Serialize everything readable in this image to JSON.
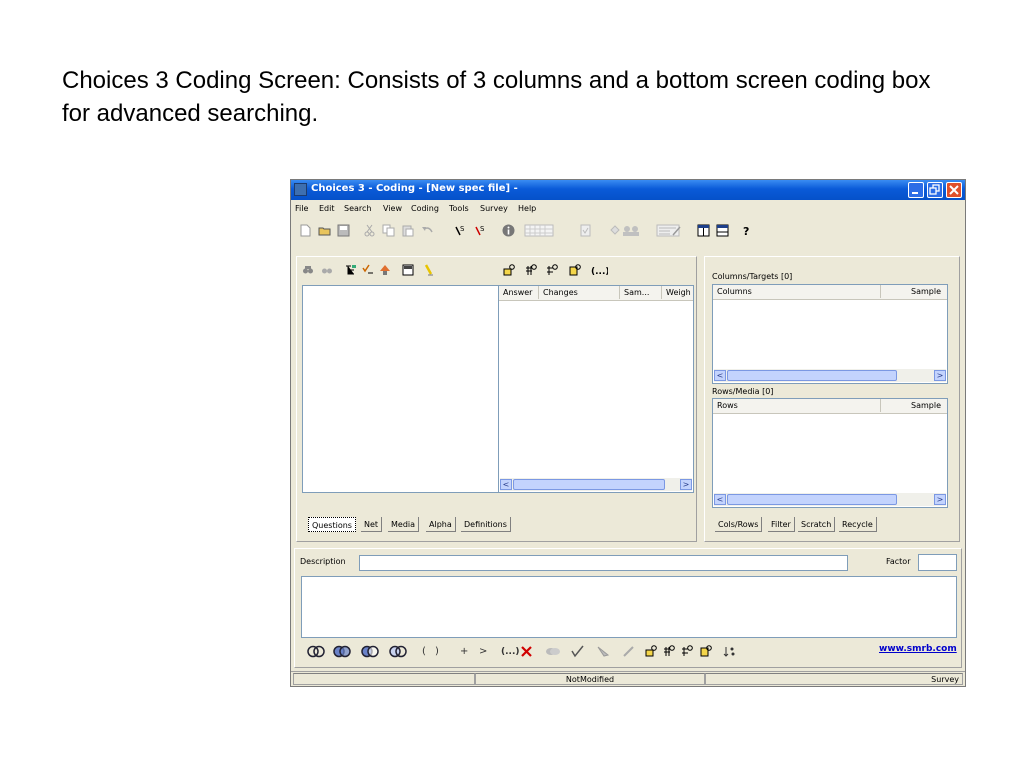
{
  "caption": "Choices 3 Coding Screen:  Consists of 3 columns and a bottom screen coding box for advanced searching.",
  "window": {
    "title": "Choices 3 - Coding - [New spec file] -"
  },
  "menu": [
    "File",
    "Edit",
    "Search",
    "View",
    "Coding",
    "Tools",
    "Survey",
    "Help"
  ],
  "middle_panel": {
    "columns": [
      "Answer",
      "Changes",
      "Sam...",
      "Weigh"
    ]
  },
  "left_tabs": [
    "Questions",
    "Net",
    "Media",
    "Alpha",
    "Definitions"
  ],
  "right_panel": {
    "columns_group_label": "Columns/Targets [0]",
    "columns_table_headers": [
      "Columns",
      "Sample"
    ],
    "rows_group_label": "Rows/Media [0]",
    "rows_table_headers": [
      "Rows",
      "Sample"
    ]
  },
  "right_tabs": [
    "Cols/Rows",
    "Filter",
    "Scratch",
    "Recycle"
  ],
  "coding_box": {
    "description_label": "Description",
    "factor_label": "Factor",
    "website_link": "www.smrb.com"
  },
  "bottom_tools_text": {
    "open_paren": "(",
    "close_paren": ")",
    "plus": "+",
    "greater": ">",
    "ellipsis": "(...)"
  },
  "status": {
    "state": "NotModified",
    "mode": "Survey"
  },
  "colors": {
    "titlebar": "#0a5ad8",
    "window_bg": "#ece9d8",
    "link": "#0000cc"
  }
}
